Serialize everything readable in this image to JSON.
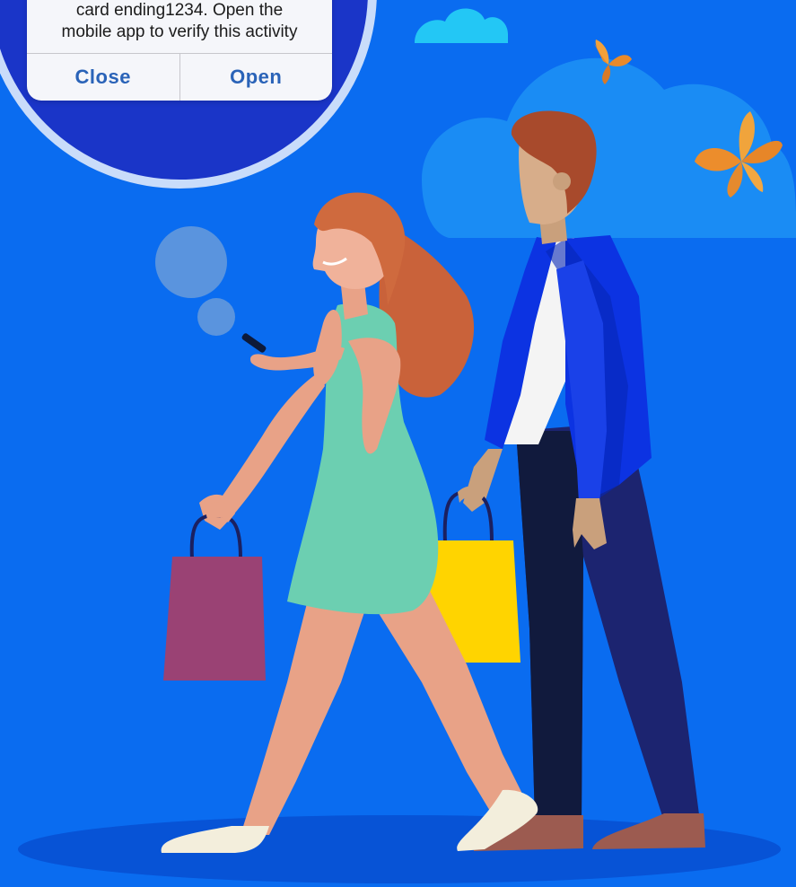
{
  "notification": {
    "message_line1": "card ending1234. Open the",
    "message_line2": "mobile app to verify this activity",
    "close_label": "Close",
    "open_label": "Open"
  },
  "colors": {
    "background": "#0a6cf0",
    "bubble": "#1a35c8",
    "button_text": "#2a63b8",
    "dress": "#6ccfb1",
    "purple_bag": "#9a4274",
    "yellow_bag": "#ffd400",
    "jacket": "#0b34e0",
    "trousers": "#1c2470"
  },
  "icons": [
    "cloud-icon",
    "butterfly-icon"
  ]
}
